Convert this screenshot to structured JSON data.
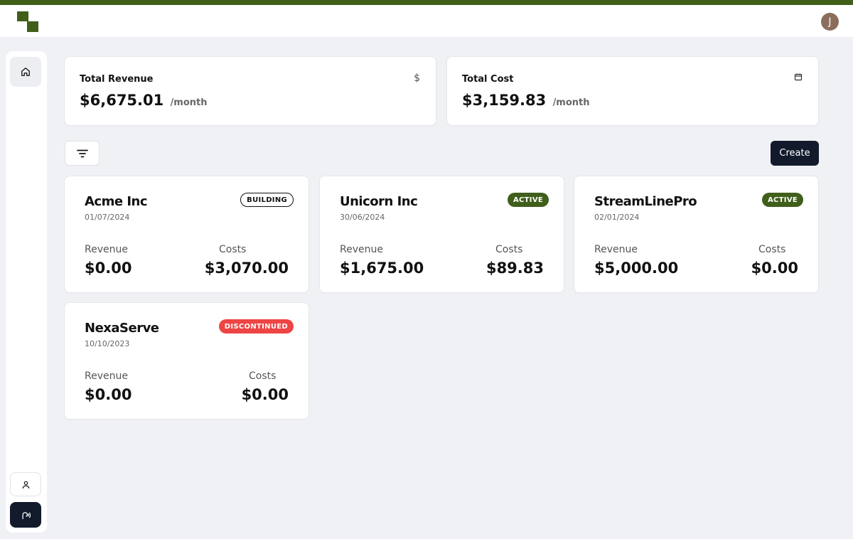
{
  "header": {
    "avatar_initial": "J"
  },
  "stats": {
    "revenue": {
      "title": "Total Revenue",
      "value": "$6,675.01",
      "unit": "/month",
      "icon": "dollar-icon",
      "icon_glyph": "$"
    },
    "cost": {
      "title": "Total Cost",
      "value": "$3,159.83",
      "unit": "/month",
      "icon": "calendar-icon"
    }
  },
  "toolbar": {
    "create_label": "Create"
  },
  "projects": [
    {
      "name": "Acme Inc",
      "date": "01/07/2024",
      "status": "BUILDING",
      "revenue_label": "Revenue",
      "revenue": "$0.00",
      "costs_label": "Costs",
      "costs": "$3,070.00"
    },
    {
      "name": "Unicorn Inc",
      "date": "30/06/2024",
      "status": "ACTIVE",
      "revenue_label": "Revenue",
      "revenue": "$1,675.00",
      "costs_label": "Costs",
      "costs": "$89.83"
    },
    {
      "name": "StreamLinePro",
      "date": "02/01/2024",
      "status": "ACTIVE",
      "revenue_label": "Revenue",
      "revenue": "$5,000.00",
      "costs_label": "Costs",
      "costs": "$0.00"
    },
    {
      "name": "NexaServe",
      "date": "10/10/2023",
      "status": "DISCONTINUED",
      "revenue_label": "Revenue",
      "revenue": "$0.00",
      "costs_label": "Costs",
      "costs": "$0.00"
    }
  ],
  "colors": {
    "brand": "#3f5f1a",
    "dark": "#121a2c",
    "danger": "#ef4444",
    "background": "#f0f1f5"
  }
}
